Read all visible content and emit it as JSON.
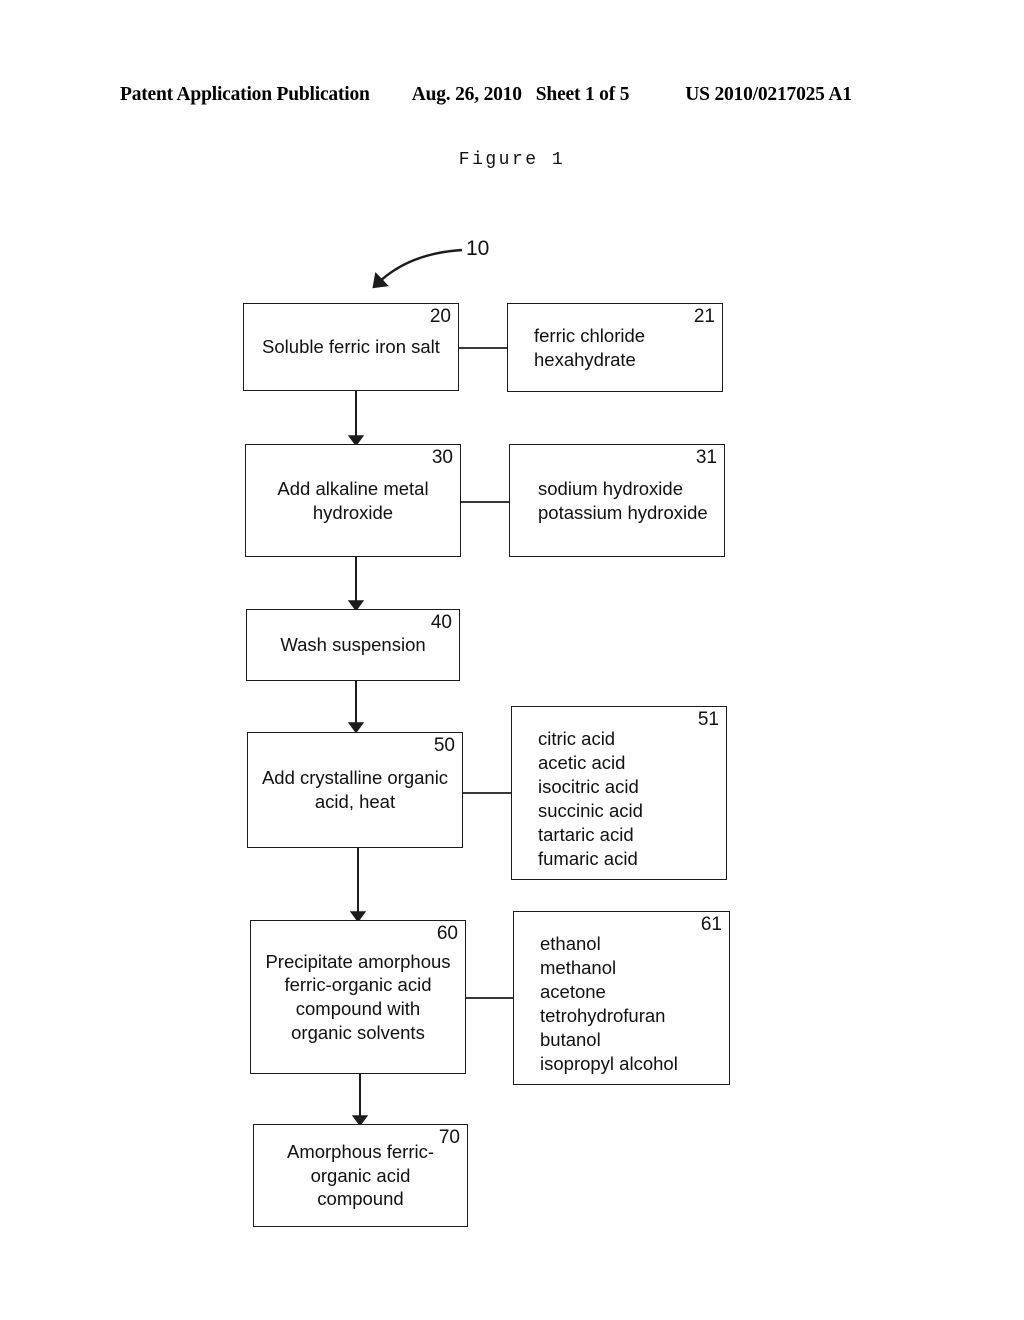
{
  "header": {
    "publication": "Patent Application Publication",
    "date": "Aug. 26, 2010",
    "sheet": "Sheet 1 of 5",
    "number": "US 2010/0217025 A1"
  },
  "figure": {
    "caption": "Figure 1",
    "overall_ref": "10"
  },
  "diagram": {
    "type": "flowchart",
    "nodes": [
      {
        "ref": "20",
        "label": "Soluble ferric iron salt"
      },
      {
        "ref": "21",
        "label": "ferric chloride\nhexahydrate"
      },
      {
        "ref": "30",
        "label": "Add alkaline metal\nhydroxide"
      },
      {
        "ref": "31",
        "label": "sodium hydroxide\npotassium hydroxide"
      },
      {
        "ref": "40",
        "label": "Wash suspension"
      },
      {
        "ref": "50",
        "label": "Add crystalline organic\nacid, heat"
      },
      {
        "ref": "51",
        "label": "citric acid\nacetic acid\nisocitric acid\nsuccinic acid\ntartaric acid\nfumaric acid"
      },
      {
        "ref": "60",
        "label": "Precipitate amorphous\nferric-organic acid\ncompound with\norganic solvents"
      },
      {
        "ref": "61",
        "label": "ethanol\nmethanol\nacetone\ntetrohydrofuran\nbutanol\nisopropyl alcohol"
      },
      {
        "ref": "70",
        "label": "Amorphous ferric-\norganic acid\ncompound"
      }
    ],
    "colors": {
      "stroke": "#1c1c1c",
      "text": "#111111",
      "background": "#ffffff"
    }
  }
}
